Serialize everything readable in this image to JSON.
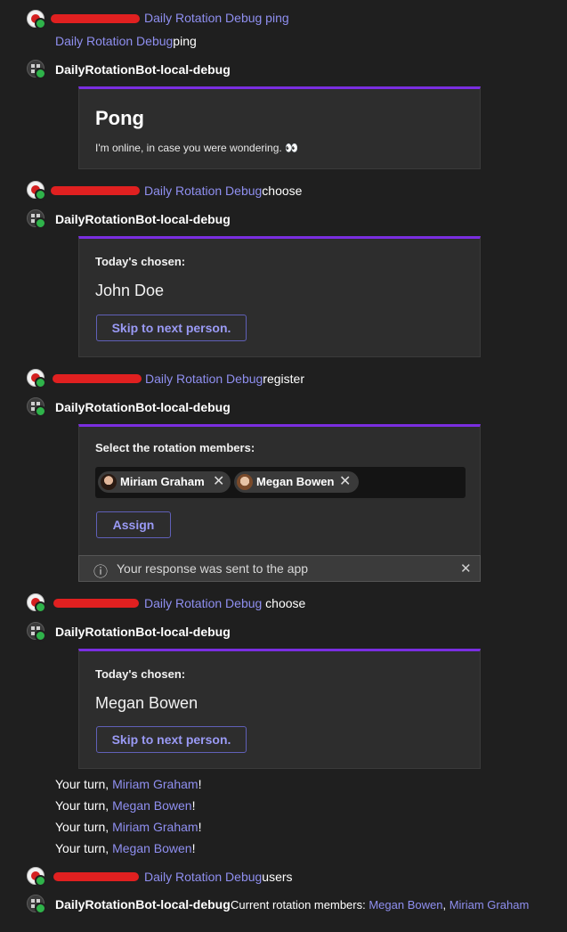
{
  "messages": {
    "m1": {
      "mention": "Daily Rotation Debug ping",
      "sub_mention": "Daily Rotation Debug",
      "sub_text": "ping"
    },
    "bot_name": "DailyRotationBot-local-debug",
    "pong_card": {
      "title": "Pong",
      "text": "I'm online, in case you were wondering. 👀"
    },
    "m2": {
      "mention": "Daily Rotation Debug",
      "text": "choose"
    },
    "choose_card_1": {
      "label": "Today's chosen:",
      "name": "John Doe",
      "button": "Skip to next person."
    },
    "m3": {
      "mention": "Daily Rotation Debug",
      "text": "register"
    },
    "register_card": {
      "label": "Select the rotation members:",
      "members": [
        "Miriam Graham",
        "Megan Bowen"
      ],
      "remove_glyph": "✕",
      "button": "Assign"
    },
    "banner": {
      "text": "Your response was sent to the app",
      "info_glyph": "ⓘ",
      "close_glyph": "✕"
    },
    "m4": {
      "mention": "Daily Rotation Debug",
      "text": " choose"
    },
    "choose_card_2": {
      "label": "Today's chosen:",
      "name": "Megan Bowen",
      "button": "Skip to next person."
    },
    "turns": [
      {
        "prefix": "Your turn, ",
        "name": "Miriam Graham",
        "suffix": "!"
      },
      {
        "prefix": "Your turn, ",
        "name": "Megan Bowen",
        "suffix": "!"
      },
      {
        "prefix": "Your turn, ",
        "name": "Miriam Graham",
        "suffix": "!"
      },
      {
        "prefix": "Your turn, ",
        "name": "Megan Bowen",
        "suffix": "!"
      }
    ],
    "m5": {
      "mention": "Daily Rotation Debug",
      "text": "users"
    },
    "final": {
      "prefix": "Current rotation members: ",
      "names": [
        "Megan Bowen",
        "Miriam Graham"
      ],
      "separator": ", "
    }
  },
  "colors": {
    "accent": "#7a2ee0",
    "mention": "#8f8ff0",
    "presence": "#2fb34a",
    "redaction": "#e02020"
  }
}
